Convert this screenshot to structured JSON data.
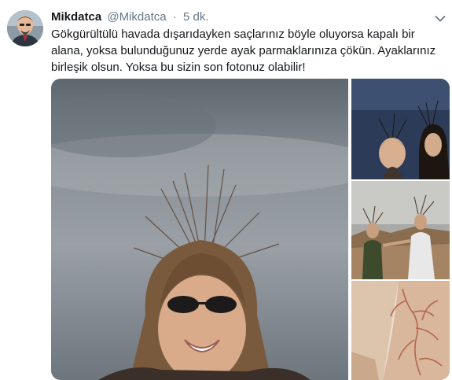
{
  "tweet": {
    "author_name": "Mikdatca",
    "author_handle": "@Mikdatca",
    "separator": "·",
    "timestamp": "5 dk.",
    "text": "Gökgürültülü havada dışarıdayken saçlarınız böyle oluyorsa kapalı bir alana, yoksa bulunduğunuz yerde ayak parmaklarınıza çökün. Ayaklarınız birleşik olsun. Yoksa bu sizin son fotonuz olabilir!",
    "menu_icon": "chevron-down-icon",
    "avatar_icon": "user-avatar"
  },
  "colors": {
    "name": "#14171a",
    "secondary": "#657786",
    "chevron": "#657786"
  }
}
